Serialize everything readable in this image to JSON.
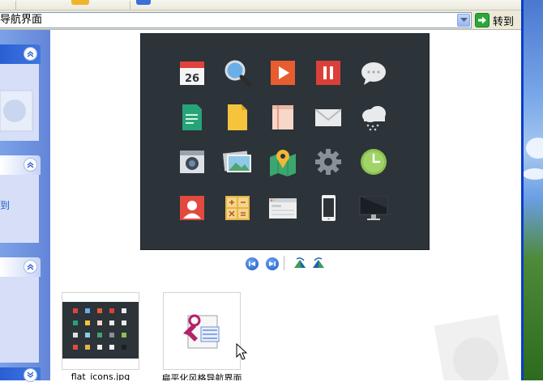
{
  "address_bar": {
    "text": "导航界面",
    "go_label": "转到"
  },
  "task_pane": {
    "link_label": "到"
  },
  "thumbnails": [
    {
      "caption": "flat_icons.jpg",
      "kind": "image"
    },
    {
      "caption": "扁平化风格导航界面",
      "kind": "file"
    }
  ],
  "icons": [
    "calendar-icon",
    "search-icon",
    "play-icon",
    "pause-icon",
    "chat-icon",
    "document-icon",
    "file-icon",
    "notebook-icon",
    "mail-icon",
    "weather-icon",
    "camera-icon",
    "photos-icon",
    "map-icon",
    "gear-icon",
    "clock-icon",
    "contact-icon",
    "calculator-icon",
    "browser-icon",
    "phone-icon",
    "monitor-icon"
  ],
  "calendar_day": "26",
  "colors": {
    "preview_bg": "#2c3339",
    "xp_blue": "#2a5fd4",
    "go_green": "#2aa838"
  }
}
